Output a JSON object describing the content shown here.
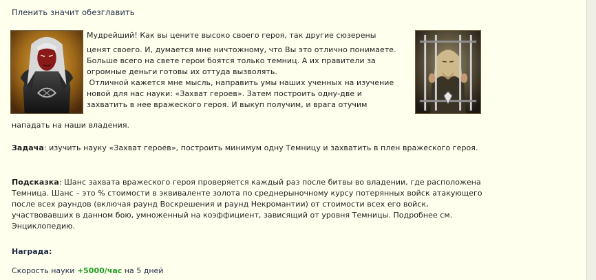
{
  "quest": {
    "title": "Пленить значит обезглавить",
    "story_lines": [
      "Мудрейший! Как вы цените высоко своего героя, так другие сюзерены",
      "ценят своего. И, думается мне ничтожному, что Вы это отлично понимаете.",
      "Больше всего на свете герои боятся только темниц. А их правители за",
      "огромные деньги готовы их оттуда вызволять.",
      " Отличной кажется мне мысль, направить умы наших ученных на изучение",
      "новой для нас науки: «Захват героев». Затем построить одну-две и",
      "захватить в нее вражеского героя. И выкуп получим, и врага отучим",
      "нападать на наши владения."
    ],
    "task_label": "Задача",
    "task_text": ": изучить науку «Захват героев», построить минимум одну Темницу и захватить в плен вражеского героя.",
    "hint_label": "Подсказка",
    "hint_text": ": Шанс захвата вражеского героя проверяется каждый раз после битвы во владении, где расположена Темница. Шанс – это % стоимости в эквиваленте золота по среднерыночному курсу потерянных войск атакующего после всех раундов (включая раунд Воскрешения и раунд Некромантии) от стоимости всех его войск, участвовавших в данном бою, умноженный на коэффициент, зависящий от уровня Темницы. Подробнее см. Энциклопедию.",
    "reward_label": "Награда:",
    "reward_prefix": "Скорость науки",
    "reward_value": "+5000/час",
    "reward_suffix": "на 5 дней"
  },
  "colors": {
    "background": "#ffffee",
    "title_text": "#1e2a44",
    "reward_value": "#1c9c20"
  },
  "images": {
    "left_portrait": "dark-elf-hero-portrait",
    "right_portrait": "captive-hero-behind-bars-portrait"
  }
}
